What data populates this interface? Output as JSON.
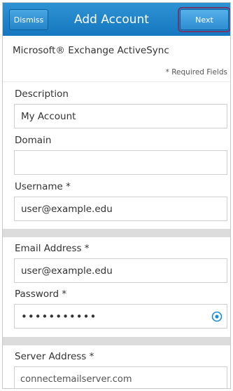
{
  "header": {
    "title": "Add Account",
    "dismiss_label": "Dismiss",
    "next_label": "Next"
  },
  "account_type": "Microsoft® Exchange ActiveSync",
  "required_note": "* Required Fields",
  "fields": {
    "description": {
      "label": "Description",
      "value": "My Account"
    },
    "domain": {
      "label": "Domain",
      "value": ""
    },
    "username": {
      "label": "Username *",
      "value": "user@example.edu"
    },
    "email": {
      "label": "Email Address *",
      "value": "user@example.edu"
    },
    "password": {
      "label": "Password *",
      "value": "•••••••••••"
    },
    "server": {
      "label": "Server Address *",
      "value": "connectemailserver.com"
    }
  },
  "icons": {
    "password_toggle": "eye-icon"
  },
  "colors": {
    "header": "#1e84c8",
    "accent": "#1a8fd6",
    "separator": "#dcdcdc"
  }
}
